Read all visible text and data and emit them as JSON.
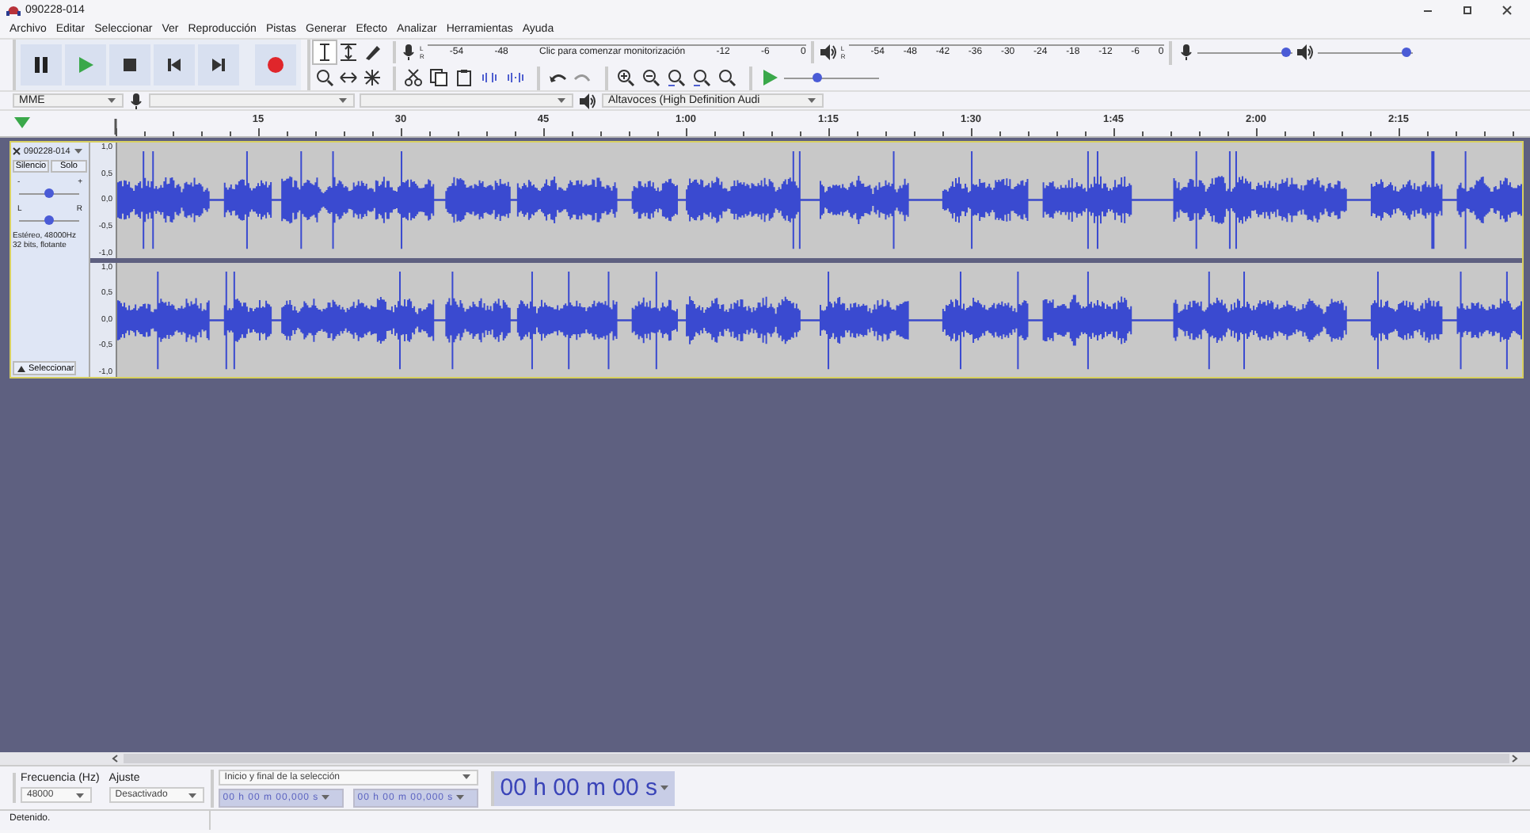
{
  "window": {
    "title": "090228-014"
  },
  "menu": [
    "Archivo",
    "Editar",
    "Seleccionar",
    "Ver",
    "Reproducción",
    "Pistas",
    "Generar",
    "Efecto",
    "Analizar",
    "Herramientas",
    "Ayuda"
  ],
  "record_meter": {
    "channels": [
      "L",
      "R"
    ],
    "ticks": [
      "-54",
      "-48"
    ],
    "prompt": "Clic para comenzar monitorización",
    "ticks_after": [
      "-12",
      "-6",
      "0"
    ]
  },
  "playback_meter": {
    "channels": [
      "L",
      "R"
    ],
    "ticks": [
      "-54",
      "-48",
      "-42",
      "-36",
      "-30",
      "-24",
      "-18",
      "-12",
      "-6",
      "0"
    ]
  },
  "mixer": {
    "record": {
      "level": 0.98
    },
    "playback": {
      "level": 0.98
    }
  },
  "play_at_speed": {
    "level": 0.33
  },
  "devices": {
    "host": "MME",
    "output": "Altavoces (High Definition Audi"
  },
  "ruler": [
    "15",
    "30",
    "45",
    "1:00",
    "1:15",
    "1:30",
    "1:45",
    "2:00",
    "2:15"
  ],
  "track": {
    "name": "090228-014",
    "buttons": [
      "Silencio",
      "Solo"
    ],
    "gain": {
      "min": "-",
      "max": "+",
      "level": 0.5
    },
    "pan": {
      "min": "L",
      "max": "R",
      "level": 0.5
    },
    "info": [
      "Estéreo, 48000Hz",
      "32 bits, flotante"
    ],
    "collapse": "Seleccionar",
    "channels": [
      {
        "scale": [
          "1,0",
          "0,5",
          "0,0",
          "-0,5",
          "-1,0"
        ]
      },
      {
        "scale": [
          "1,0",
          "0,5",
          "0,0",
          "-0,5",
          "-1,0"
        ]
      }
    ]
  },
  "selection_bar": {
    "rate_label": "Frecuencia (Hz)",
    "snap_label": "Ajuste",
    "rate": "48000",
    "snap": "Desactivado",
    "mode": "Inicio y final de la selección",
    "start": "00 h 00 m 00,000 s",
    "end": "00 h 00 m 00,000 s"
  },
  "time": "00 h 00 m 00 s",
  "status": "Detenido."
}
